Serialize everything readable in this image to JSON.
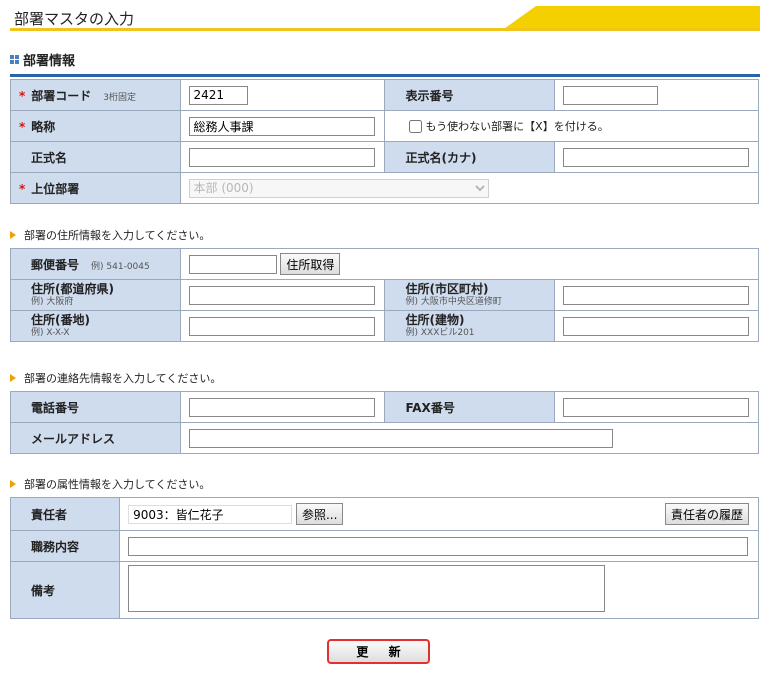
{
  "page": {
    "title": "部署マスタの入力"
  },
  "dept_info": {
    "heading": "部署情報",
    "code_label": "部署コード",
    "code_hint": "3桁固定",
    "code_value": "2421",
    "display_no_label": "表示番号",
    "display_no_value": "",
    "short_name_label": "略称",
    "short_name_value": "総務人事課",
    "unused_checkbox_label": "もう使わない部署に【X】を付ける。",
    "formal_name_label": "正式名",
    "formal_name_value": "",
    "formal_kana_label": "正式名(カナ)",
    "formal_kana_value": "",
    "parent_label": "上位部署",
    "parent_selected": "本部 (000)"
  },
  "address": {
    "note": "部署の住所情報を入力してください。",
    "zip_label": "郵便番号",
    "zip_hint": "例) 541-0045",
    "zip_value": "",
    "fetch_button": "住所取得",
    "pref_label": "住所(都道府県)",
    "pref_hint": "例) 大阪府",
    "city_label": "住所(市区町村)",
    "city_hint": "例) 大阪市中央区道修町",
    "street_label": "住所(番地)",
    "street_hint": "例) X-X-X",
    "building_label": "住所(建物)",
    "building_hint": "例) XXXビル201"
  },
  "contact": {
    "note": "部署の連絡先情報を入力してください。",
    "phone_label": "電話番号",
    "fax_label": "FAX番号",
    "email_label": "メールアドレス"
  },
  "attributes": {
    "note": "部署の属性情報を入力してください。",
    "manager_label": "責任者",
    "manager_value": "9003：皆仁花子",
    "ref_button": "参照...",
    "history_button": "責任者の履歴",
    "duty_label": "職務内容",
    "remarks_label": "備考"
  },
  "actions": {
    "update_button": "更 新"
  },
  "colors": {
    "label_bg": "#cfdcee",
    "accent_yellow": "#f5d000",
    "rule_blue": "#2a63ad",
    "required": "#dd1111"
  }
}
